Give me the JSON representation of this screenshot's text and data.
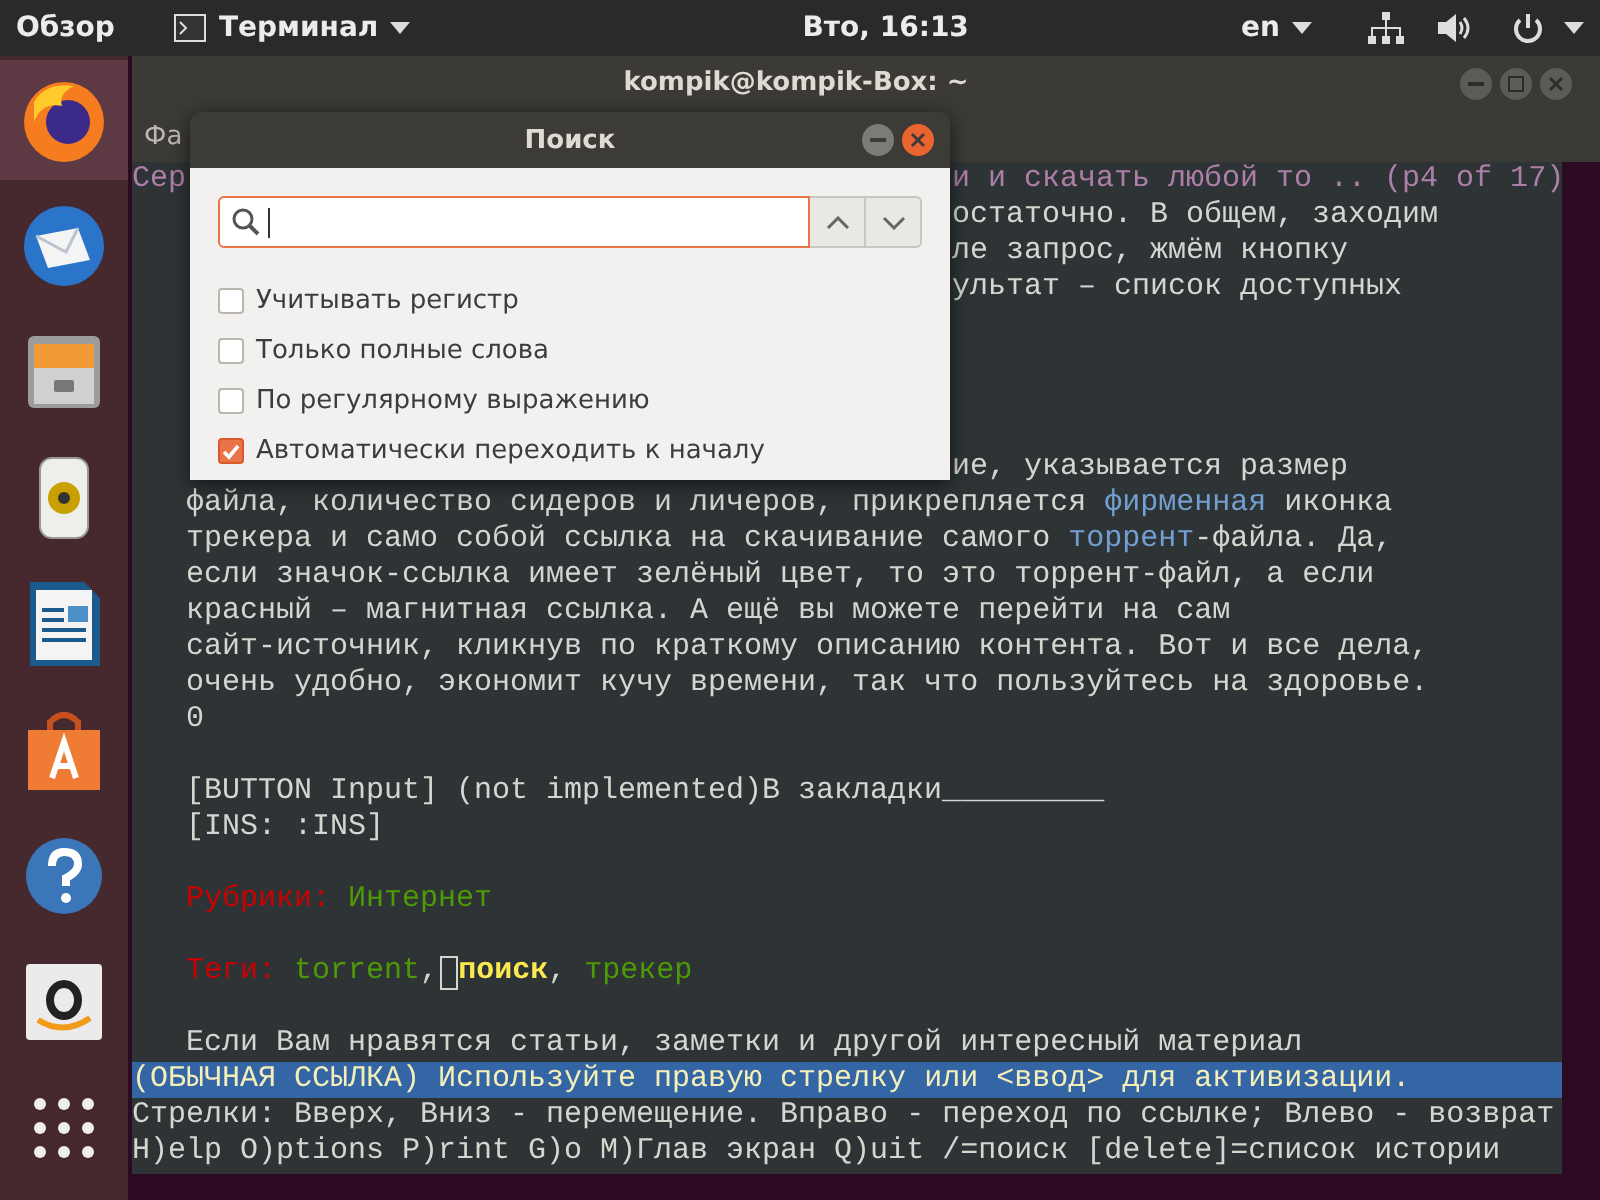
{
  "top_bar": {
    "activities": "Обзор",
    "app_menu": "Терминал",
    "clock": "Вто, 16:13",
    "language": "en"
  },
  "dock": {
    "items": [
      {
        "kind": "browser",
        "selected": true
      },
      {
        "kind": "mail",
        "selected": false
      },
      {
        "kind": "files",
        "selected": false
      },
      {
        "kind": "music",
        "selected": false
      },
      {
        "kind": "document",
        "selected": false
      },
      {
        "kind": "store",
        "selected": false
      },
      {
        "kind": "help",
        "selected": false
      },
      {
        "kind": "amazon",
        "selected": false
      },
      {
        "kind": "apps",
        "selected": false
      }
    ]
  },
  "terminal": {
    "title": "kompik@kompik-Box: ~",
    "menu": "Фа",
    "lines": [
      {
        "kind": "title",
        "segments": [
          {
            "kind": "plain",
            "text": "Сер"
          }
        ],
        "tail": "и и скачать любой то .. (p4 of 17)"
      },
      {
        "kind": "clipped",
        "segments": [
          {
            "kind": "plain",
            "text": "остаточно. В общем, заходим"
          }
        ]
      },
      {
        "kind": "clipped",
        "segments": [
          {
            "kind": "plain",
            "text": "ле запрос, жмём кнопку"
          }
        ]
      },
      {
        "kind": "clipped",
        "segments": [
          {
            "kind": "plain",
            "text": "ультат – список доступных"
          }
        ]
      },
      {
        "kind": "blank"
      },
      {
        "kind": "blank"
      },
      {
        "kind": "blank"
      },
      {
        "kind": "blank"
      },
      {
        "kind": "clipped",
        "segments": [
          {
            "kind": "plain",
            "text": "ие, указывается размер"
          }
        ]
      },
      {
        "kind": "text",
        "segments": [
          {
            "kind": "plain",
            "text": "файла, количество сидеров и личеров, прикрепляется"
          },
          {
            "kind": "link",
            "text": "фирменная"
          },
          {
            "kind": "plain",
            "text": " иконка"
          }
        ]
      },
      {
        "kind": "text",
        "segments": [
          {
            "kind": "plain",
            "text": "трекера и само собой ссылка на скачивание самого"
          },
          {
            "kind": "link",
            "text": "торрент"
          },
          {
            "kind": "plain",
            "text": "-файла. Да,"
          }
        ]
      },
      {
        "kind": "text",
        "segments": [
          {
            "kind": "plain",
            "text": "если значок-ссылка имеет зелёный цвет, то это торрент-файл, а если"
          }
        ]
      },
      {
        "kind": "text",
        "segments": [
          {
            "kind": "plain",
            "text": "красный – магнитная ссылка. А ещё вы можете перейти на сам"
          }
        ]
      },
      {
        "kind": "text",
        "segments": [
          {
            "kind": "plain",
            "text": "сайт-источник, кликнув по краткому описанию контента. Вот и все дела,"
          }
        ]
      },
      {
        "kind": "text",
        "segments": [
          {
            "kind": "plain",
            "text": "очень удобно, экономит кучу времени, так что пользуйтесь на здоровье."
          }
        ]
      },
      {
        "kind": "text",
        "segments": [
          {
            "kind": "plain",
            "text": "0"
          }
        ]
      },
      {
        "kind": "blank"
      },
      {
        "kind": "text",
        "segments": [
          {
            "kind": "plain",
            "text": "[BUTTON Input] (not implemented)В закладки_________"
          }
        ]
      },
      {
        "kind": "text",
        "segments": [
          {
            "kind": "plain",
            "text": "[INS: :INS]"
          }
        ]
      },
      {
        "kind": "blank"
      },
      {
        "kind": "text",
        "segments": [
          {
            "kind": "label",
            "text": "Рубрики:"
          },
          {
            "kind": "tag",
            "text": "Интернет"
          }
        ]
      },
      {
        "kind": "blank"
      },
      {
        "kind": "text",
        "segments": [
          {
            "kind": "label",
            "text": "Теги:"
          },
          {
            "kind": "tag",
            "text": "torrent"
          },
          {
            "kind": "plain",
            "text": ","
          },
          {
            "kind": "cursor"
          },
          {
            "kind": "current",
            "text": "поиск"
          },
          {
            "kind": "plain",
            "text": ","
          },
          {
            "kind": "tag",
            "text": "трекер"
          }
        ]
      },
      {
        "kind": "blank"
      },
      {
        "kind": "text",
        "segments": [
          {
            "kind": "plain",
            "text": "Если Вам нравятся статьи, заметки и другой интересный материал"
          }
        ]
      },
      {
        "kind": "status",
        "segments": [
          {
            "kind": "plain",
            "text": "(ОБЫЧНАЯ ССЫЛКА) Используйте правую стрелку или <ввод> для активизации."
          }
        ]
      },
      {
        "kind": "help",
        "segments": [
          {
            "kind": "plain",
            "text": "Стрелки: Вверх, Вниз - перемещение. Вправо - переход по ссылке; Влево - возврат"
          }
        ]
      },
      {
        "kind": "help",
        "segments": [
          {
            "kind": "plain",
            "text": "H)elp O)ptions P)rint G)o M)Глав экран Q)uit /=поиск [delete]=список истории"
          }
        ]
      }
    ]
  },
  "search_dialog": {
    "title": "Поиск",
    "options": [
      {
        "label": "Учитывать регистр",
        "checked": false
      },
      {
        "label": "Только полные слова",
        "checked": false
      },
      {
        "label": "По регулярному выражению",
        "checked": false
      },
      {
        "label": "Автоматически переходить к началу",
        "checked": true
      }
    ]
  }
}
